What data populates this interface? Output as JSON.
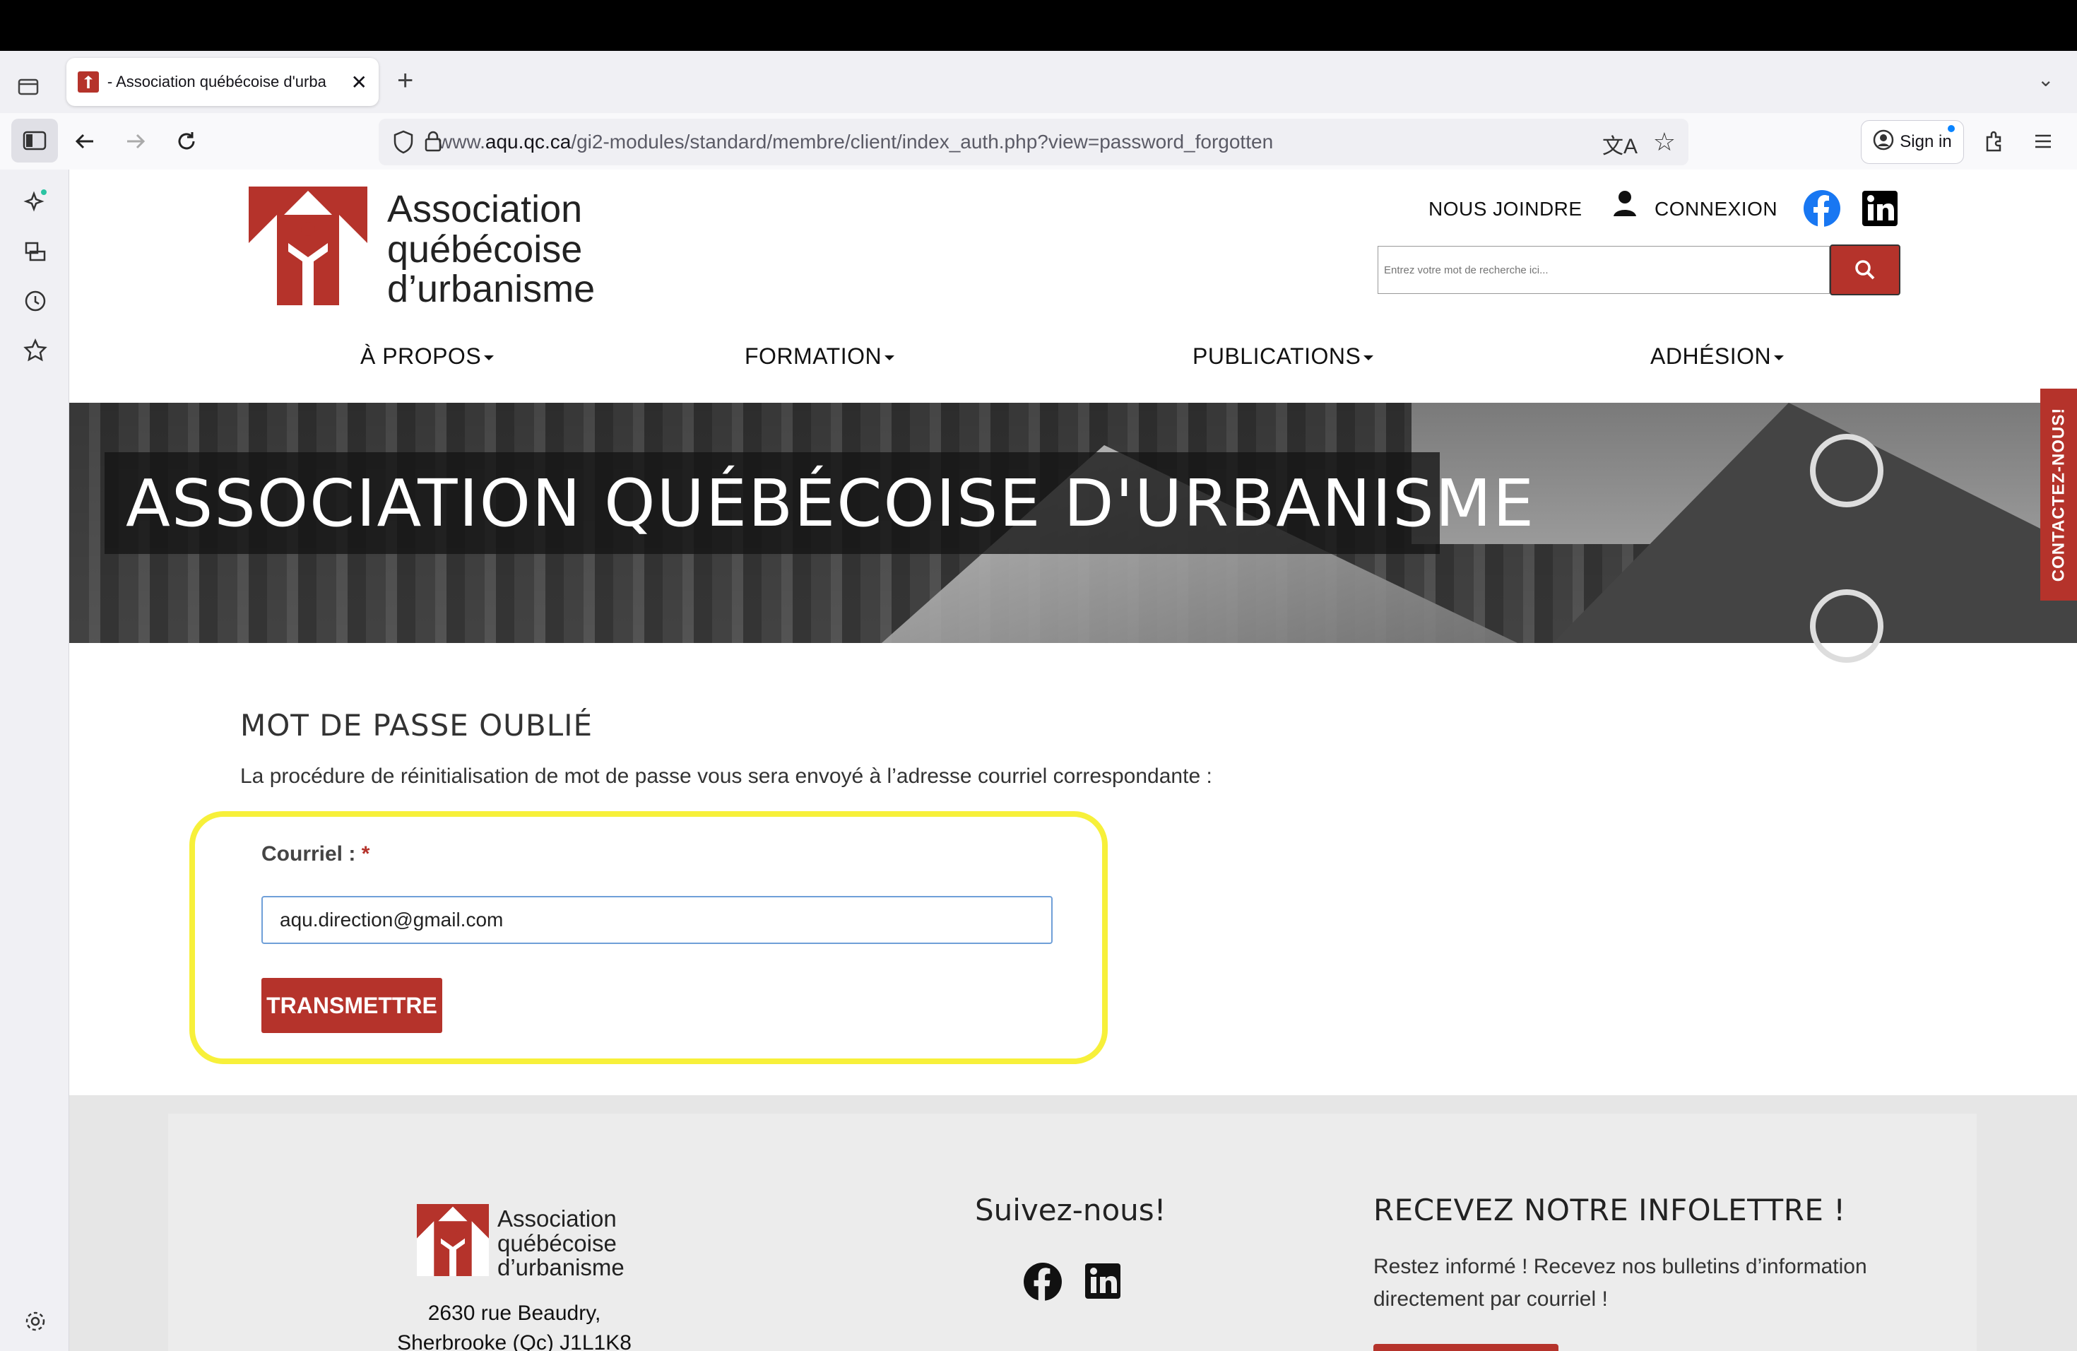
{
  "browser": {
    "tab_title": "- Association québécoise d'urba",
    "url_prefix": "www.",
    "url_domain": "aqu.qc.ca",
    "url_path": "/gi2-modules/standard/membre/client/index_auth.php?view=password_forgotten",
    "signin_label": "Sign in"
  },
  "header": {
    "logo_line1": "Association",
    "logo_line2": "québécoise",
    "logo_line3": "d’urbanisme",
    "link_contact": "NOUS JOINDRE",
    "link_login": "CONNEXION",
    "search_placeholder": "Entrez votre mot de recherche ici..."
  },
  "menu": {
    "items": [
      {
        "label": "À PROPOS"
      },
      {
        "label": "FORMATION"
      },
      {
        "label": "PUBLICATIONS"
      },
      {
        "label": "ADHÉSION"
      }
    ]
  },
  "hero": {
    "title": "ASSOCIATION QUÉBÉCOISE D'URBANISME",
    "contact_tab": "CONTACTEZ-NOUS!"
  },
  "form": {
    "title": "MOT DE PASSE OUBLIÉ",
    "description": "La procédure de réinitialisation de mot de passe vous sera envoyé à l’adresse courriel correspondante :",
    "email_label": "Courriel :",
    "required_mark": "*",
    "email_value": "aqu.direction@gmail.com",
    "submit_label": "TRANSMETTRE"
  },
  "footer": {
    "address_line1": "2630 rue Beaudry,",
    "address_line2": "Sherbrooke (Qc) J1L1K8",
    "follow_title": "Suivez-nous!",
    "newsletter_title": "RECEVEZ NOTRE INFOLETTRE !",
    "newsletter_text": "Restez informé ! Recevez nos bulletins d’information directement par courriel !"
  },
  "colors": {
    "brand_red": "#b5332b",
    "highlight_yellow": "#f7f03a",
    "facebook_blue": "#1877f2"
  }
}
